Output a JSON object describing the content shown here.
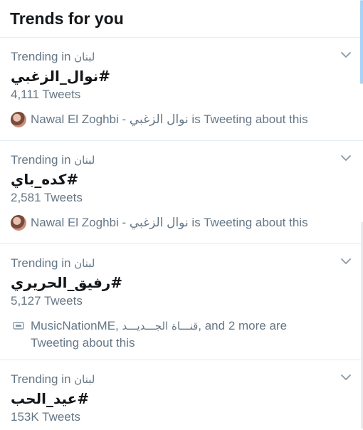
{
  "header": {
    "title": "Trends for you"
  },
  "trends": [
    {
      "context_prefix": "Trending in",
      "context_location": "لبنان",
      "name": "#نوال_الزغبي",
      "count": "4,111 Tweets",
      "about": {
        "user": "Nawal El Zoghbi - نوال الزغبي",
        "suffix": " is Tweeting about this"
      }
    },
    {
      "context_prefix": "Trending in",
      "context_location": "لبنان",
      "name": "#كده_باي",
      "count": "2,581 Tweets",
      "about": {
        "user": "Nawal El Zoghbi - نوال الزغبي",
        "suffix": " is Tweeting about this"
      }
    },
    {
      "context_prefix": "Trending in",
      "context_location": "لبنان",
      "name": "#رفيق_الحريري",
      "count": "5,127 Tweets",
      "about": {
        "line1_a": "MusicNationME, ",
        "line1_b": "قنـــاة الجـــديـــد",
        "line1_c": ", and 2 more are",
        "line2": "Tweeting about this"
      }
    },
    {
      "context_prefix": "Trending in",
      "context_location": "لبنان",
      "name": "#عيد_الحب",
      "count": "153K Tweets"
    }
  ],
  "icons": {
    "chevron": "chevron-down-icon",
    "avatar": "avatar",
    "music": "music-icon"
  },
  "colors": {
    "text": "#14171a",
    "secondary": "#657786",
    "divider": "#e6ecf0",
    "accent": "#1da1f2"
  }
}
